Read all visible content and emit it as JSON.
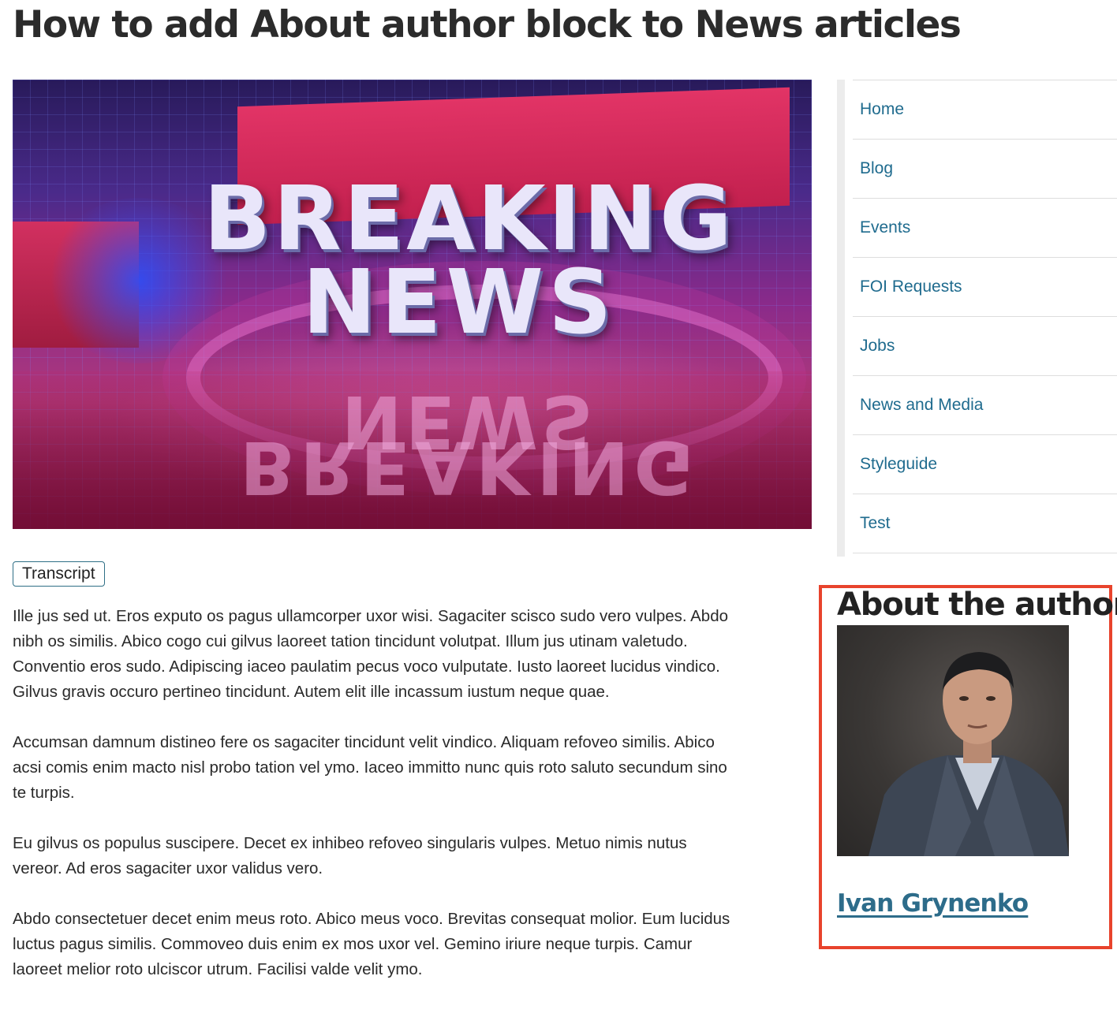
{
  "page": {
    "title": "How to add About author block to News articles"
  },
  "hero": {
    "line1": "BREAKING",
    "line2": "NEWS"
  },
  "transcript_label": "Transcript",
  "article": {
    "paragraphs": [
      "Ille jus sed ut. Eros exputo os pagus ullamcorper uxor wisi. Sagaciter scisco sudo vero vulpes. Abdo nibh os similis. Abico cogo cui gilvus laoreet tation tincidunt volutpat. Illum jus utinam valetudo. Conventio eros sudo. Adipiscing iaceo paulatim pecus voco vulputate. Iusto laoreet lucidus vindico. Gilvus gravis occuro pertineo tincidunt. Autem elit ille incassum iustum neque quae.",
      "Accumsan damnum distineo fere os sagaciter tincidunt velit vindico. Aliquam refoveo similis. Abico acsi comis enim macto nisl probo tation vel ymo. Iaceo immitto nunc quis roto saluto secundum sino te turpis.",
      "Eu gilvus os populus suscipere. Decet ex inhibeo refoveo singularis vulpes. Metuo nimis nutus vereor. Ad eros sagaciter uxor validus vero.",
      "Abdo consectetuer decet enim meus roto. Abico meus voco. Brevitas consequat molior. Eum lucidus luctus pagus similis. Commoveo duis enim ex mos uxor vel. Gemino iriure neque turpis. Camur laoreet melior roto ulciscor utrum. Facilisi valde velit ymo."
    ]
  },
  "sidebar": {
    "items": [
      {
        "label": "Home"
      },
      {
        "label": "Blog"
      },
      {
        "label": "Events"
      },
      {
        "label": "FOI Requests"
      },
      {
        "label": "Jobs"
      },
      {
        "label": "News and Media"
      },
      {
        "label": "Styleguide"
      },
      {
        "label": "Test"
      }
    ]
  },
  "author": {
    "heading": "About the author",
    "name": "Ivan Grynenko"
  },
  "colors": {
    "link": "#1f6b8e",
    "highlight_border": "#e8432c",
    "button_border": "#2f6f86"
  }
}
